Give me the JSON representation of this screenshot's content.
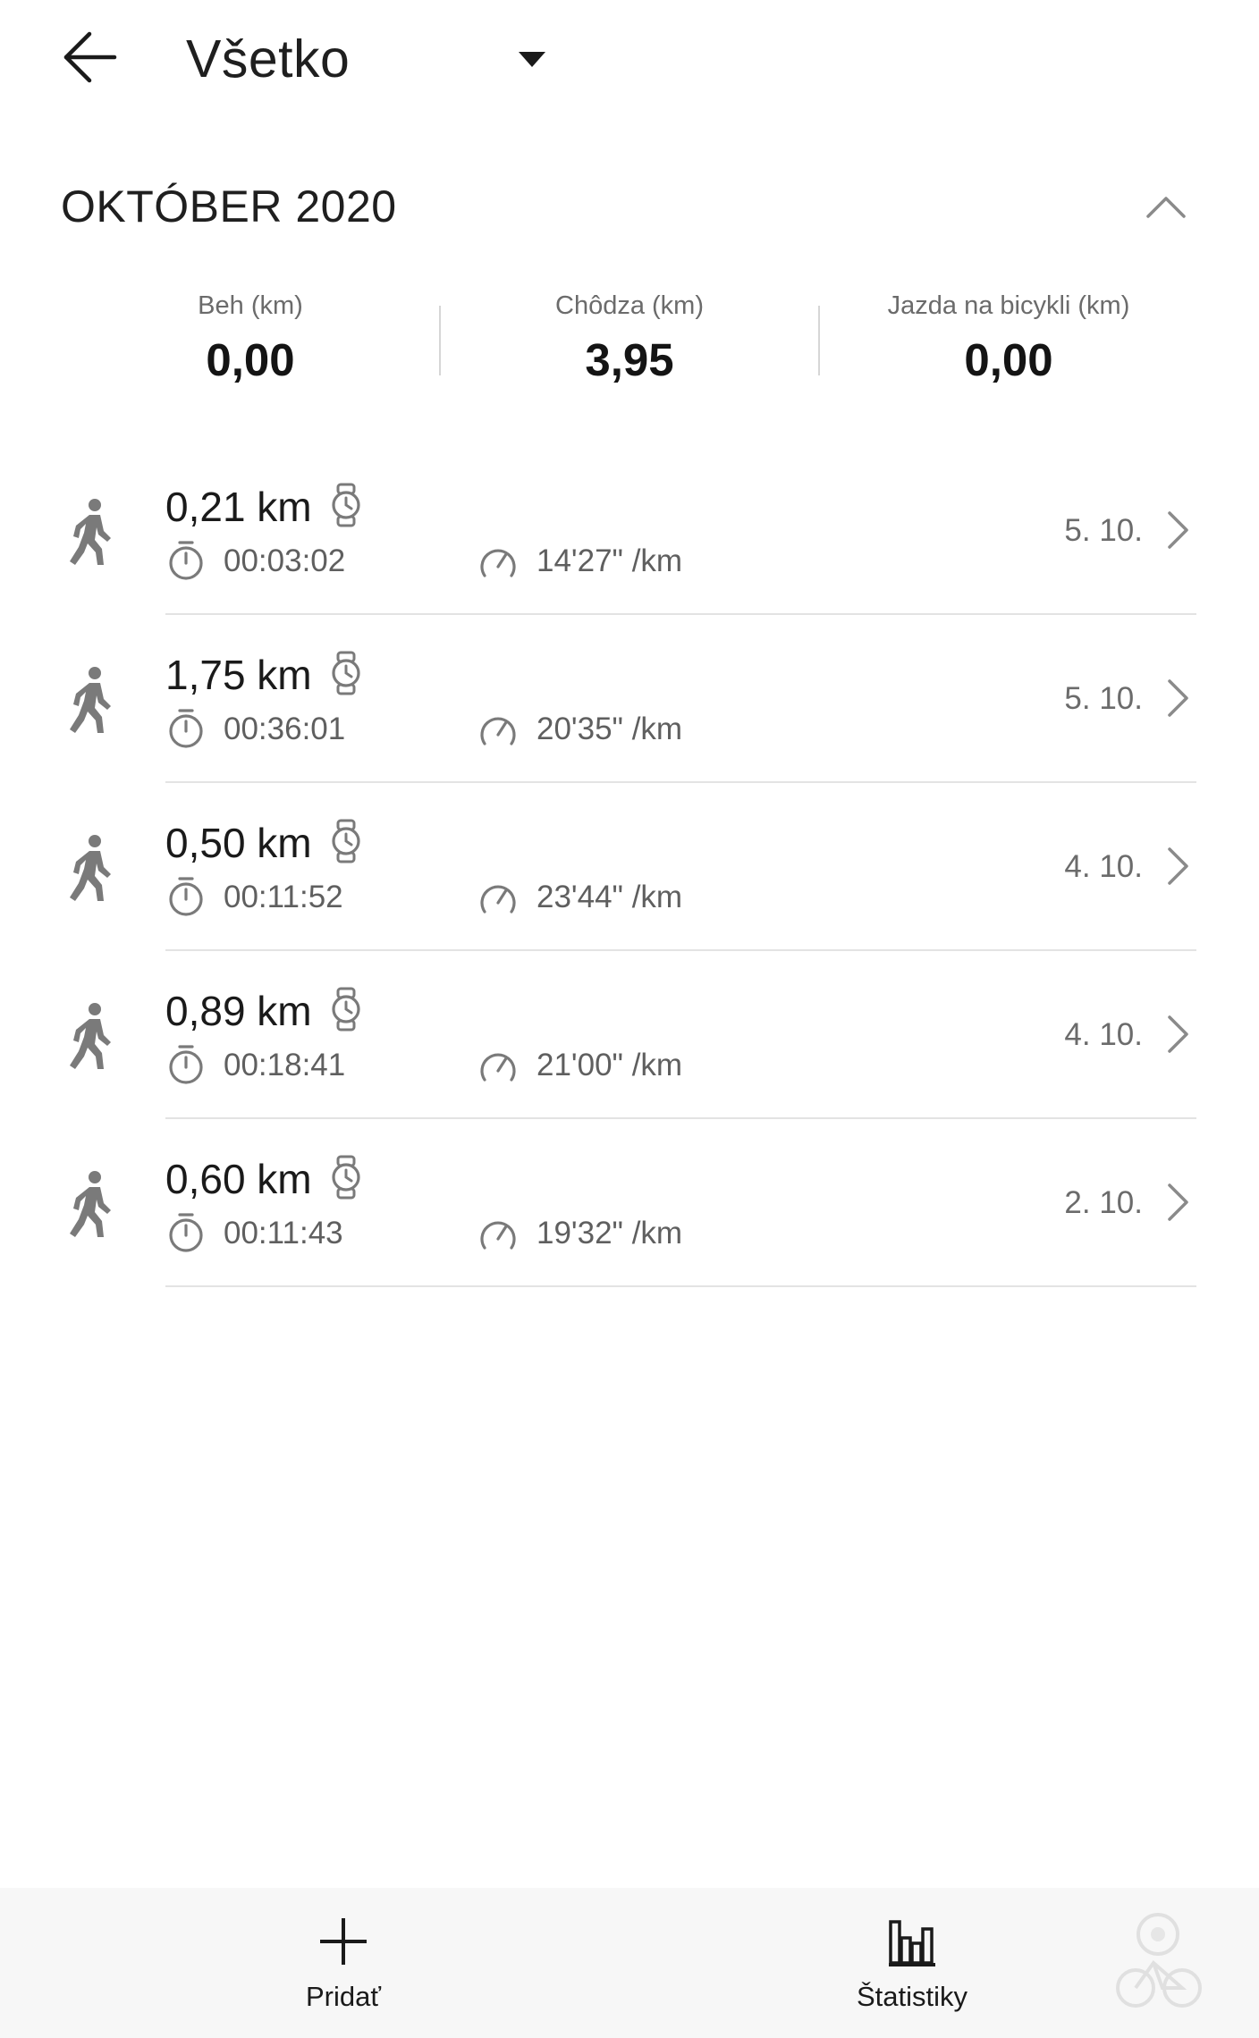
{
  "header": {
    "back_icon": "arrow-left-icon",
    "filter_label": "Všetko",
    "filter_caret_icon": "caret-down-icon"
  },
  "month": {
    "title": "OKTÓBER 2020",
    "collapse_icon": "chevron-up-icon"
  },
  "summary": [
    {
      "label": "Beh (km)",
      "value": "0,00"
    },
    {
      "label": "Chôdza (km)",
      "value": "3,95"
    },
    {
      "label": "Jazda na bicykli (km)",
      "value": "0,00"
    }
  ],
  "activities": [
    {
      "type_icon": "walking-person-icon",
      "distance": "0,21 km",
      "duration": "00:03:02",
      "pace": "14'27\" /km",
      "date": "5. 10."
    },
    {
      "type_icon": "walking-person-icon",
      "distance": "1,75 km",
      "duration": "00:36:01",
      "pace": "20'35\" /km",
      "date": "5. 10."
    },
    {
      "type_icon": "walking-person-icon",
      "distance": "0,50 km",
      "duration": "00:11:52",
      "pace": "23'44\" /km",
      "date": "4. 10."
    },
    {
      "type_icon": "walking-person-icon",
      "distance": "0,89 km",
      "duration": "00:18:41",
      "pace": "21'00\" /km",
      "date": "4. 10."
    },
    {
      "type_icon": "walking-person-icon",
      "distance": "0,60 km",
      "duration": "00:11:43",
      "pace": "19'32\" /km",
      "date": "2. 10."
    }
  ],
  "bottom_nav": {
    "add": {
      "label": "Pridať",
      "icon": "plus-icon"
    },
    "stats": {
      "label": "Štatistiky",
      "icon": "bar-chart-icon"
    }
  },
  "colors": {
    "text_primary": "#1a1a1a",
    "text_secondary": "#6b6b6b",
    "icon_gray": "#7a7a7a",
    "divider": "#e3e3e3",
    "nav_background": "#f7f7f7"
  }
}
